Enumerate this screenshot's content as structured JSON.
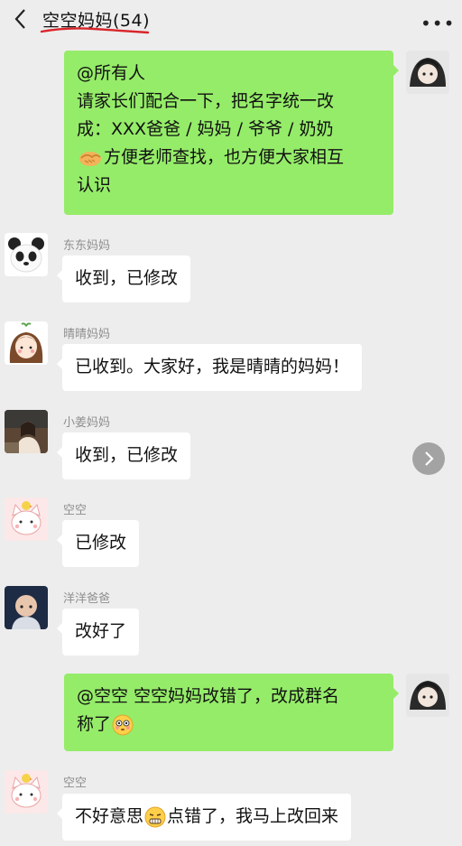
{
  "header": {
    "title": "空空妈妈(54)",
    "back_icon": "chevron-left-icon",
    "more_icon": "more-dots-icon",
    "more_label": "•••"
  },
  "messages": [
    {
      "side": "sent",
      "lines": [
        "@所有人",
        "请家长们配合一下，把名字统一改",
        "成：XXX爸爸 / 妈妈 / 爷爷 / 奶奶"
      ],
      "line4_after_emoji": "方便老师查找，也方便大家相互",
      "line5": "认识",
      "emoji": "handshake-emoji"
    },
    {
      "side": "recv",
      "sender": "东东妈妈",
      "text": "收到，已修改",
      "avatar": "panda-avatar"
    },
    {
      "side": "recv",
      "sender": "晴晴妈妈",
      "text": "已收到。大家好，我是晴晴的妈妈！",
      "avatar": "cartoon-girl-avatar"
    },
    {
      "side": "recv",
      "sender": "小姜妈妈",
      "text": "收到，已修改",
      "avatar": "photo-woman-avatar"
    },
    {
      "side": "recv",
      "sender": "空空",
      "text": "已修改",
      "avatar": "cat-avatar"
    },
    {
      "side": "recv",
      "sender": "洋洋爸爸",
      "text": "改好了",
      "avatar": "child-photo-avatar"
    },
    {
      "side": "sent",
      "line1": "@空空 空空妈妈改错了，改成群名",
      "line2": "称了",
      "emoji": "flushed-emoji"
    },
    {
      "side": "recv",
      "sender": "空空",
      "text_before": "不好意思",
      "text_after": "点错了，我马上改回来",
      "avatar": "cat-avatar",
      "emoji": "grimace-emoji"
    }
  ],
  "forward_icon": "forward-arrow-icon",
  "colors": {
    "sent_bubble": "#95ec69",
    "recv_bubble": "#ffffff",
    "background": "#ededed",
    "title_underline": "#d9252a"
  }
}
